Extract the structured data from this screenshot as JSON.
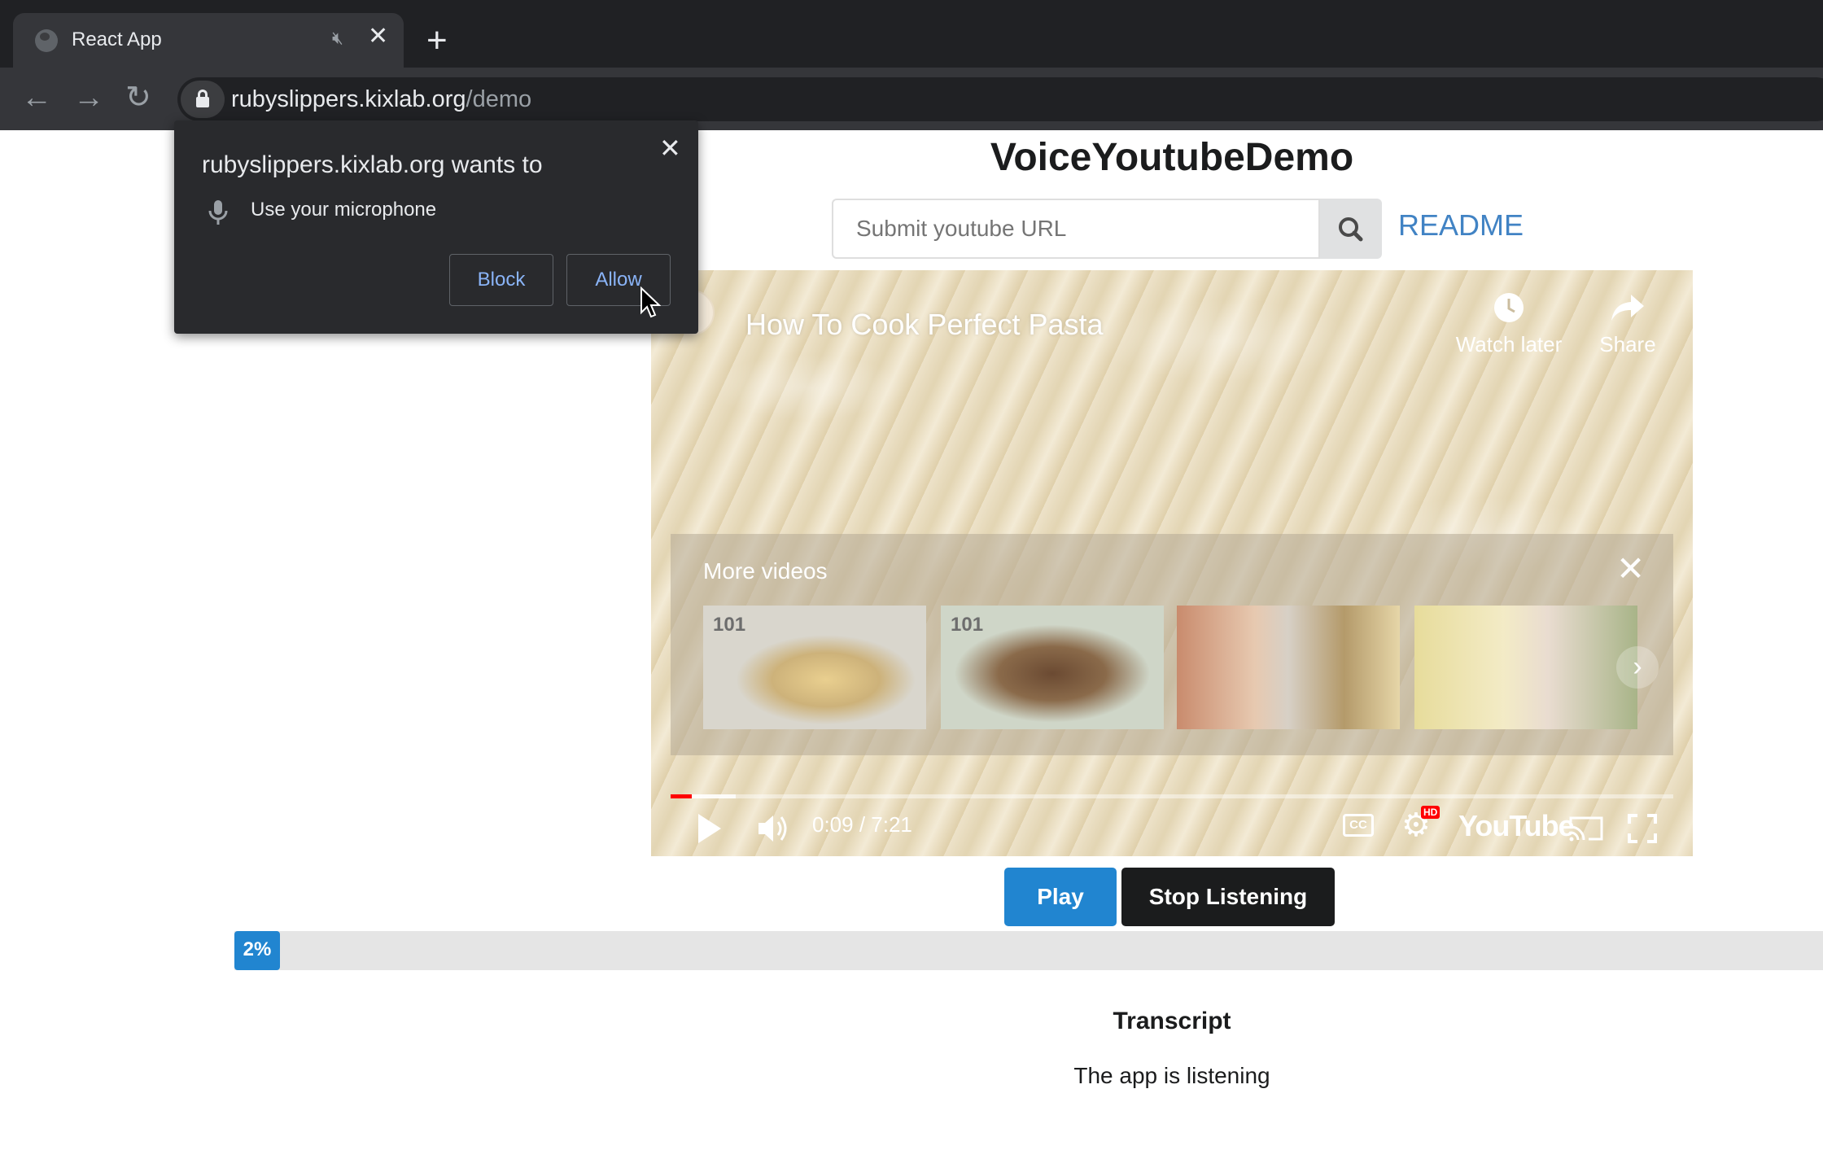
{
  "browser": {
    "tab_title": "React App",
    "tab_audio_icon": "speaker-muted-icon",
    "tab_close": "✕",
    "new_tab": "+",
    "url_host": "rubyslippers.kixlab.org",
    "url_path": "/demo"
  },
  "permission_popup": {
    "title": "rubyslippers.kixlab.org wants to",
    "request": "Use your microphone",
    "close": "✕",
    "block_label": "Block",
    "allow_label": "Allow"
  },
  "page": {
    "title": "VoiceYoutubeDemo",
    "search_placeholder": "Submit youtube URL",
    "readme_label": "README"
  },
  "video": {
    "title": "How To Cook Perfect Pasta",
    "watch_later_label": "Watch later",
    "share_label": "Share",
    "more_videos_label": "More videos",
    "more_close": "✕",
    "thumb_badge_1": "101",
    "thumb_badge_2": "101",
    "time_display": "0:09 / 7:21",
    "cc_label": "CC",
    "hd_label": "HD",
    "youtube_logo": "YouTube",
    "played_fraction": 0.021,
    "buffered_fraction": 0.065
  },
  "controls": {
    "play_label": "Play",
    "stop_label": "Stop Listening"
  },
  "listening_progress": {
    "label": "2%",
    "percent": 2
  },
  "transcript": {
    "heading": "Transcript",
    "text": "The app is listening"
  },
  "colors": {
    "primary_blue": "#2185d0",
    "link_blue": "#4183c4",
    "chrome_dark": "#202124",
    "popup_bg": "#292a2d",
    "popup_button_text": "#8ab4f8"
  }
}
